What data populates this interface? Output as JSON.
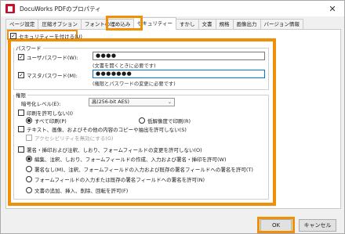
{
  "window": {
    "title": "DocuWorks PDFのプロパティ",
    "close_glyph": "✕"
  },
  "tabs": [
    {
      "label": "ページ設定"
    },
    {
      "label": "圧縮オプション"
    },
    {
      "label": "フォントの埋め込み"
    },
    {
      "label": "セキュリティー"
    },
    {
      "label": "すかし"
    },
    {
      "label": "文書"
    },
    {
      "label": "規格"
    },
    {
      "label": "画像出力"
    },
    {
      "label": "バージョン情報"
    }
  ],
  "security": {
    "enable_label": "セキュリティーを付ける(U)",
    "enable_checked": true,
    "password_section": {
      "title": "パスワード",
      "user_pw_label": "ユーザパスワード(W):",
      "user_pw_checked": true,
      "user_pw_value": "●●●●",
      "user_pw_hint": "(文書を開くときに必要です)",
      "master_pw_label": "マスタパスワード(M):",
      "master_pw_checked": true,
      "master_pw_value": "●●●●●●●",
      "master_pw_hint": "(権限とパスワードの変更に必要です)"
    },
    "permissions": {
      "title": "権限",
      "enc_level_label": "暗号化レベル(E):",
      "enc_level_value": "高(256-bit AES)",
      "allow_print_label": "印刷を許可しない(I)",
      "print_all_label": "すべて印刷(P)",
      "print_low_label": "低解像度で印刷(R)",
      "no_copy_label": "テキスト、画像、およびその他の内容のコピーや抽出を許可しない(S)",
      "accessibility_label": "アクセシビリティを無効にする(G)",
      "no_change_label": "署名・挿印および注釈、しおり、フォームフィールドの変更を許可しない(O)",
      "change_options": [
        {
          "label": "編集、注釈、しおり、フォームフィールドの作成、入力および署名・挿印を許可(W)",
          "selected": true
        },
        {
          "label": "署名なし(M)、注釈、フォームフィールドの入力および既存の署名フィールドへの署名を許可(T)",
          "selected": false
        },
        {
          "label": "フォームフィールドの入力または既存の署名フィールドへの署名を許可(N)",
          "selected": false
        },
        {
          "label": "文書の追加、挿入、削除、回転を許可(F)",
          "selected": false
        }
      ]
    }
  },
  "buttons": {
    "ok": "OK",
    "cancel": "キャンセル"
  },
  "colors": {
    "highlight": "#f0900a",
    "focus_border": "#0078d7"
  }
}
